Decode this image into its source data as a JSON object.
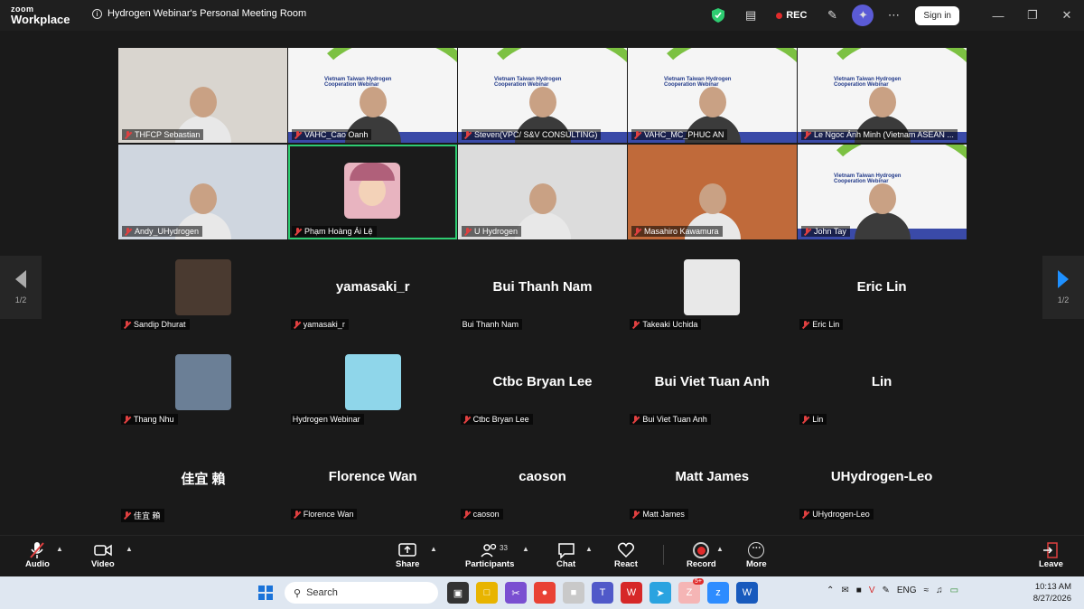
{
  "window": {
    "brand_line1": "zoom",
    "brand_line2": "Workplace",
    "meeting_title": "Hydrogen Webinar's Personal Meeting Room",
    "rec_label": "REC",
    "signin_label": "Sign in",
    "icons": [
      "shield-icon",
      "notes-icon",
      "rec-icon",
      "pen-icon",
      "ai-companion-icon",
      "apps-grid-icon",
      "minimize-icon",
      "restore-icon",
      "close-icon"
    ],
    "colors": {
      "accent": "#1e90ff",
      "rec": "#e02b2b",
      "active_speaker": "#2ecc71",
      "shield": "#2ecc71"
    }
  },
  "video_tiles": [
    {
      "name": "THFCP Sebastian",
      "kind": "person",
      "bg": "#d9d5cf"
    },
    {
      "name": "VAHC_Cao Oanh",
      "kind": "slide"
    },
    {
      "name": "Steven(VPC/ S&V CONSULTING)",
      "kind": "slide"
    },
    {
      "name": "VAHC_MC_PHUC AN",
      "kind": "slide"
    },
    {
      "name": "Le Ngoc Ánh Minh (Vietnam ASEAN ...",
      "kind": "slide"
    },
    {
      "name": "Andy_UHydrogen",
      "kind": "person",
      "bg": "#cfd6df"
    },
    {
      "name": "Phạm Hoàng Ái Lệ",
      "kind": "avatar",
      "bg": "#1b1b1b",
      "selected": true
    },
    {
      "name": "U Hydrogen",
      "kind": "person",
      "bg": "#dcdcdc"
    },
    {
      "name": "Masahiro Kawamura",
      "kind": "person",
      "bg": "#c06a3a"
    },
    {
      "name": "John Tay",
      "kind": "slide"
    }
  ],
  "slide_text": "Vietnam Taiwan Hydrogen Cooperation Webinar",
  "pager": {
    "prev": "1/2",
    "next": "1/2"
  },
  "audience": [
    {
      "name": "Sandip Dhurat",
      "display": "",
      "has_photo": true,
      "photo_bg": "#4a3a30"
    },
    {
      "name": "yamasaki_r",
      "display": "yamasaki_r",
      "has_photo": false
    },
    {
      "name": "Bui Thanh Nam",
      "display": "Bui Thanh Nam",
      "has_photo": false,
      "unmuted": true
    },
    {
      "name": "Takeaki Uchida",
      "display": "",
      "has_photo": true,
      "photo_bg": "#e8e8e8"
    },
    {
      "name": "Eric Lin",
      "display": "Eric Lin",
      "has_photo": false
    },
    {
      "name": "Thang Nhu",
      "display": "",
      "has_photo": true,
      "photo_bg": "#6b7f96"
    },
    {
      "name": "Hydrogen Webinar",
      "display": "",
      "has_photo": true,
      "photo_bg": "#8fd6ea",
      "unmuted": true
    },
    {
      "name": "Ctbc Bryan Lee",
      "display": "Ctbc Bryan Lee",
      "has_photo": false
    },
    {
      "name": "Bui Viet Tuan Anh",
      "display": "Bui Viet Tuan Anh",
      "has_photo": false
    },
    {
      "name": "Lin",
      "display": "Lin",
      "has_photo": false
    },
    {
      "name": "佳宜 賴",
      "display": "佳宜 賴",
      "has_photo": false
    },
    {
      "name": "Florence Wan",
      "display": "Florence Wan",
      "has_photo": false
    },
    {
      "name": "caoson",
      "display": "caoson",
      "has_photo": false
    },
    {
      "name": "Matt James",
      "display": "Matt James",
      "has_photo": false
    },
    {
      "name": "UHydrogen-Leo",
      "display": "UHydrogen-Leo",
      "has_photo": false
    }
  ],
  "toolbar": {
    "audio": "Audio",
    "video": "Video",
    "share": "Share",
    "participants": "Participants",
    "participants_count": "33",
    "chat": "Chat",
    "react": "React",
    "record": "Record",
    "more": "More",
    "leave": "Leave"
  },
  "taskbar": {
    "search_placeholder": "Search",
    "lang": "ENG",
    "time": "10:13 AM",
    "date": "8/27/2026",
    "zalo_badge": "5+"
  }
}
